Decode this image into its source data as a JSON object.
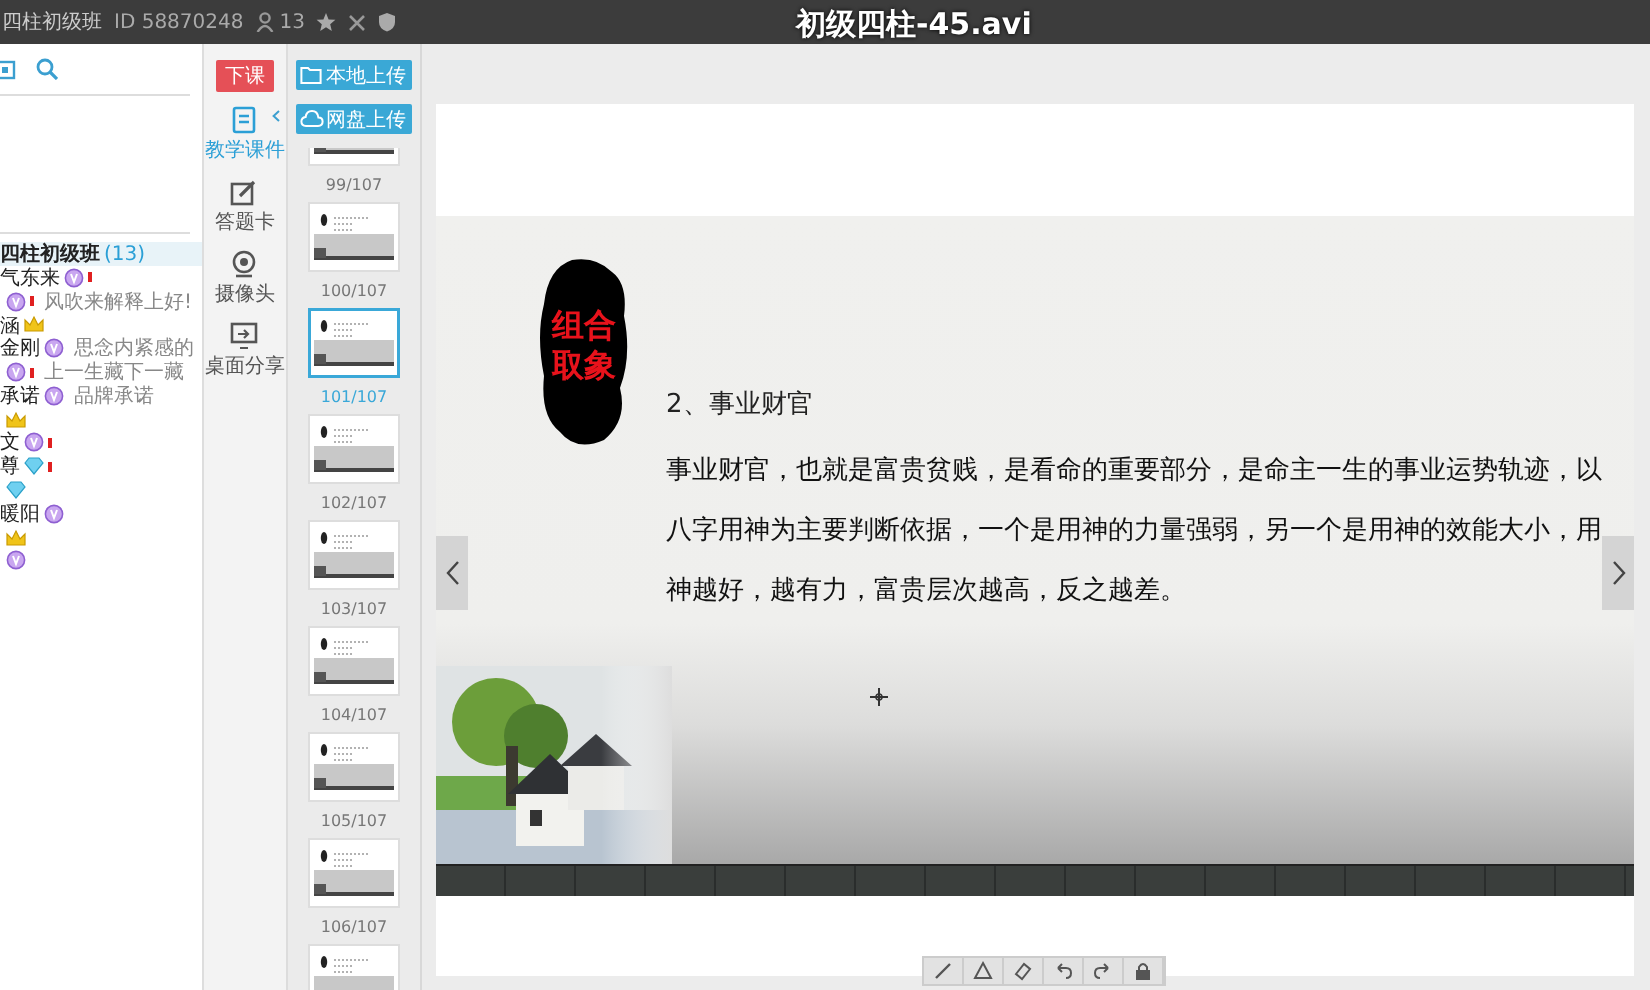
{
  "top_bar": {
    "room_name": "四柱初级班",
    "room_id": "ID 58870248",
    "member_count": "13"
  },
  "video_title": "初级四柱-45.avi",
  "chat": {
    "group": {
      "name": "四柱初级班",
      "count": "(13)",
      "selected": true
    },
    "rows": [
      {
        "kind": "member",
        "name": "气东来",
        "badge": {
          "kind": "vip"
        },
        "flag": true
      },
      {
        "kind": "message",
        "badge": {
          "kind": "vip"
        },
        "flag": true,
        "text": "风吹来解释上好!"
      },
      {
        "kind": "member",
        "name": "涵",
        "badge": {
          "kind": "crown"
        }
      },
      {
        "kind": "member",
        "name": "金刚",
        "badge": {
          "kind": "vip"
        },
        "text": "思念内紧感的"
      },
      {
        "kind": "message",
        "badge": {
          "kind": "vip"
        },
        "flag": true,
        "text": "上一生藏下一藏"
      },
      {
        "kind": "member",
        "name": "承诺",
        "badge": {
          "kind": "vip"
        },
        "text": "品牌承诺"
      },
      {
        "kind": "badge",
        "badge": {
          "kind": "crown"
        }
      },
      {
        "kind": "member",
        "name": "文",
        "badge": {
          "kind": "vip"
        },
        "flag": true
      },
      {
        "kind": "member",
        "name": "尊",
        "badge": {
          "kind": "diamond"
        },
        "flag": true
      },
      {
        "kind": "badge",
        "badge": {
          "kind": "diamond"
        }
      },
      {
        "kind": "member",
        "name": "暖阳",
        "badge": {
          "kind": "vip"
        }
      },
      {
        "kind": "badge",
        "badge": {
          "kind": "crown"
        }
      },
      {
        "kind": "badge",
        "badge": {
          "kind": "vip"
        }
      }
    ]
  },
  "tools": {
    "end_button": "下课",
    "items": [
      {
        "kind": "courseware",
        "label": "教学课件",
        "selected": true
      },
      {
        "kind": "answer-card",
        "label": "答题卡",
        "selected": false
      },
      {
        "kind": "camera",
        "label": "摄像头",
        "selected": false
      },
      {
        "kind": "screen-share",
        "label": "桌面分享",
        "selected": false
      }
    ]
  },
  "uploads": [
    {
      "kind": "local",
      "label": "本地上传"
    },
    {
      "kind": "network",
      "label": "网盘上传"
    }
  ],
  "thumbnails": [
    {
      "label": "99/107",
      "selected": false
    },
    {
      "label": "100/107",
      "selected": false
    },
    {
      "label": "101/107",
      "selected": true
    },
    {
      "label": "102/107",
      "selected": false
    },
    {
      "label": "103/107",
      "selected": false
    },
    {
      "label": "104/107",
      "selected": false
    },
    {
      "label": "105/107",
      "selected": false
    },
    {
      "label": "106/107",
      "selected": false
    },
    {
      "selected": false
    }
  ],
  "slide": {
    "tag": "组合取象",
    "heading": "2、事业财官",
    "paragraph": "事业财官，也就是富贵贫贱，是看命的重要部分，是命主一生的事业运势轨迹，以八字用神为主要判断依据，一个是用神的力量强弱，另一个是用神的效能大小，用神越好，越有力，富贵层次越高，反之越差。"
  },
  "board_tools": [
    {
      "kind": "pen"
    },
    {
      "kind": "shape"
    },
    {
      "kind": "eraser"
    },
    {
      "kind": "undo"
    },
    {
      "kind": "redo"
    },
    {
      "kind": "lock"
    }
  ]
}
